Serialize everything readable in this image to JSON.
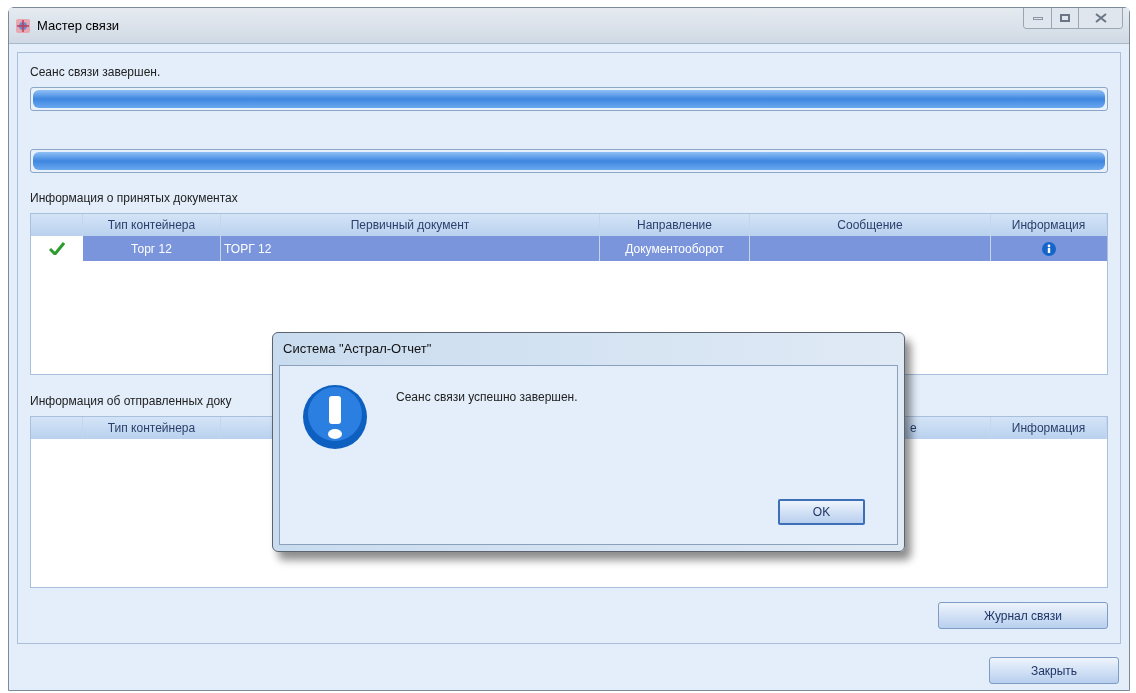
{
  "window": {
    "title": "Мастер связи"
  },
  "status": "Сеанс связи завершен.",
  "progress": [
    {
      "level": 1
    },
    {
      "level": 1
    }
  ],
  "received": {
    "title": "Информация о принятых документах",
    "columns": [
      "Тип контейнера",
      "Первичный документ",
      "Направление",
      "Сообщение",
      "Информация"
    ],
    "rows": [
      {
        "checked": true,
        "selected": true,
        "container_type": "Торг 12",
        "document": "ТОРГ 12",
        "direction": "Документооборот",
        "info_icon": true
      }
    ]
  },
  "sent": {
    "title": "Информация об отправленных доку",
    "container_type": "Тип контейнера",
    "column_5": "е",
    "info": "Информация"
  },
  "buttons": {
    "log": "Журнал связи",
    "close": "Закрыть"
  },
  "dialog": {
    "title": "Система \"Астрал-Отчет\"",
    "message": "Сеанс связи успешно завершен.",
    "ok": "OK"
  }
}
